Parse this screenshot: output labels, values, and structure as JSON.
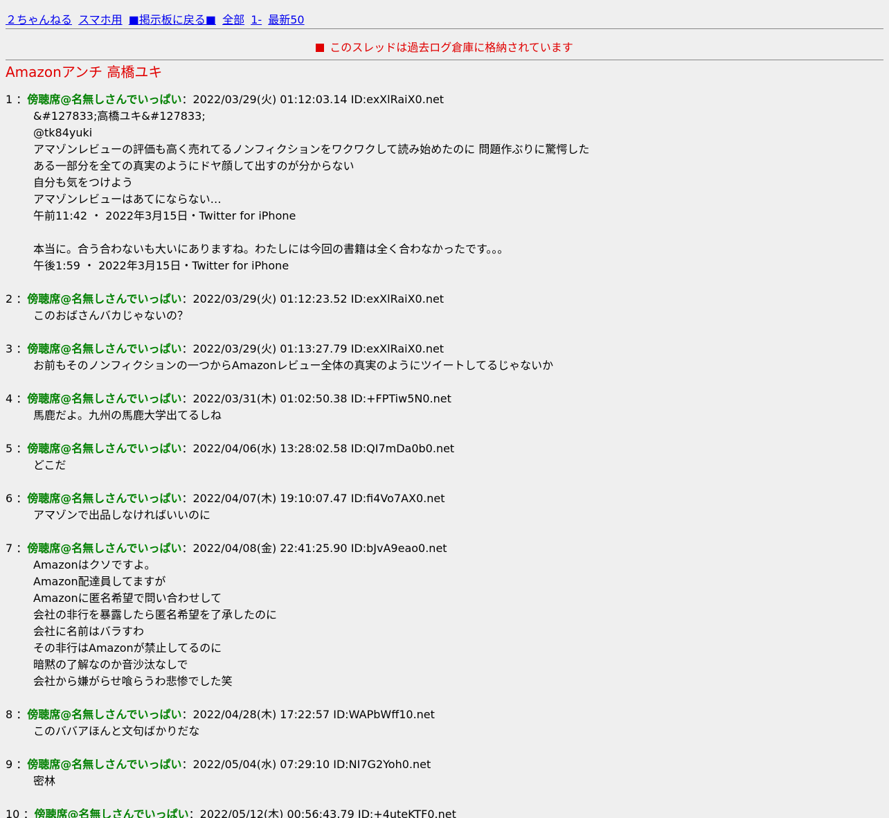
{
  "menu": [
    {
      "label": "２ちゃんねる",
      "name": "nav-2ch"
    },
    {
      "label": "スマホ用",
      "name": "nav-smartphone"
    },
    {
      "label": "■掲示板に戻る■",
      "name": "nav-back-to-board"
    },
    {
      "label": "全部",
      "name": "nav-all"
    },
    {
      "label": "1-",
      "name": "nav-range"
    },
    {
      "label": "最新50",
      "name": "nav-latest50"
    }
  ],
  "notice": "このスレッドは過去ログ倉庫に格納されています",
  "thread_title": "Amazonアンチ 高橋ユキ",
  "colors": {
    "link": "#0000ee",
    "name": "#008000",
    "title": "#e00000",
    "background": "#efefef"
  },
  "posts": [
    {
      "num": "1",
      "name": "傍聴席@名無しさんでいっぱい",
      "date": "2022/03/29(火) 01:12:03.14",
      "id": "ID:exXlRaiX0.net",
      "lines": [
        "&#127833;高橋ユキ&#127833;",
        "@tk84yuki",
        "アマゾンレビューの評価も高く売れてるノンフィクションをワクワクして読み始めたのに 問題作ぶりに驚愕した",
        "ある一部分を全ての真実のようにドヤ顔して出すのが分からない",
        "自分も気をつけよう",
        "アマゾンレビューはあてにならない…",
        "午前11:42 ・ 2022年3月15日・Twitter for iPhone",
        "",
        "本当に。合う合わないも大いにありますね。わたしには今回の書籍は全く合わなかったです。。。",
        "午後1:59 ・ 2022年3月15日・Twitter for iPhone"
      ]
    },
    {
      "num": "2",
      "name": "傍聴席@名無しさんでいっぱい",
      "date": "2022/03/29(火) 01:12:23.52",
      "id": "ID:exXlRaiX0.net",
      "lines": [
        "このおばさんバカじゃないの？"
      ]
    },
    {
      "num": "3",
      "name": "傍聴席@名無しさんでいっぱい",
      "date": "2022/03/29(火) 01:13:27.79",
      "id": "ID:exXlRaiX0.net",
      "lines": [
        "お前もそのノンフィクションの一つからAmazonレビュー全体の真実のようにツイートしてるじゃないか"
      ]
    },
    {
      "num": "4",
      "name": "傍聴席@名無しさんでいっぱい",
      "date": "2022/03/31(木) 01:02:50.38",
      "id": "ID:+FPTiw5N0.net",
      "lines": [
        "馬鹿だよ。九州の馬鹿大学出てるしね"
      ]
    },
    {
      "num": "5",
      "name": "傍聴席@名無しさんでいっぱい",
      "date": "2022/04/06(水) 13:28:02.58",
      "id": "ID:QI7mDa0b0.net",
      "lines": [
        "どこだ"
      ]
    },
    {
      "num": "6",
      "name": "傍聴席@名無しさんでいっぱい",
      "date": "2022/04/07(木) 19:10:07.47",
      "id": "ID:fi4Vo7AX0.net",
      "lines": [
        "アマゾンで出品しなければいいのに"
      ]
    },
    {
      "num": "7",
      "name": "傍聴席@名無しさんでいっぱい",
      "date": "2022/04/08(金) 22:41:25.90",
      "id": "ID:bJvA9eao0.net",
      "lines": [
        "Amazonはクソですよ。",
        "Amazon配達員してますが",
        "Amazonに匿名希望で問い合わせして",
        "会社の非行を暴露したら匿名希望を了承したのに",
        "会社に名前はバラすわ",
        "その非行はAmazonが禁止してるのに",
        "暗黙の了解なのか音沙汰なしで",
        "会社から嫌がらせ喰らうわ悲惨でした笑"
      ]
    },
    {
      "num": "8",
      "name": "傍聴席@名無しさんでいっぱい",
      "date": "2022/04/28(木) 17:22:57",
      "id": "ID:WAPbWff10.net",
      "lines": [
        "このババアほんと文句ばかりだな"
      ]
    },
    {
      "num": "9",
      "name": "傍聴席@名無しさんでいっぱい",
      "date": "2022/05/04(水) 07:29:10",
      "id": "ID:NI7G2Yoh0.net",
      "lines": [
        "密林"
      ]
    },
    {
      "num": "10",
      "name": "傍聴席@名無しさんでいっぱい",
      "date": "2022/05/12(木) 00:56:43.79",
      "id": "ID:+4uteKTF0.net",
      "lines": []
    }
  ]
}
